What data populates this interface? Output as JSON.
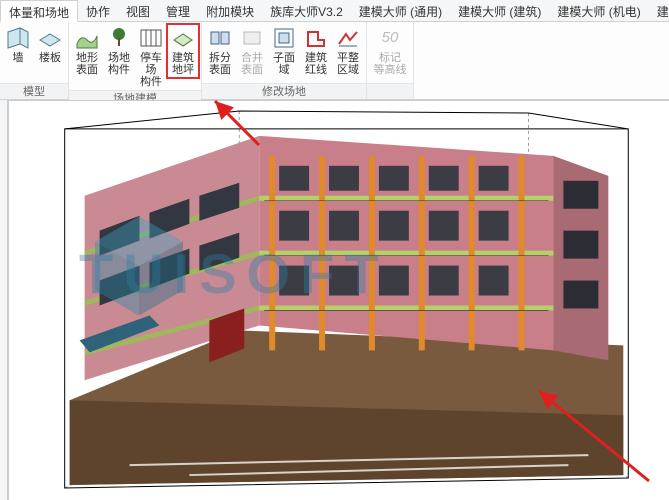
{
  "tabs": {
    "items": [
      {
        "label": "体量和场地",
        "active": true
      },
      {
        "label": "协作"
      },
      {
        "label": "视图"
      },
      {
        "label": "管理"
      },
      {
        "label": "附加模块"
      },
      {
        "label": "族库大师V3.2"
      },
      {
        "label": "建模大师 (通用)"
      },
      {
        "label": "建模大师 (建筑)"
      },
      {
        "label": "建模大师 (机电)"
      },
      {
        "label": "建模大师 (施工)"
      }
    ]
  },
  "ribbon": {
    "group0": {
      "label": "模型",
      "btn0": {
        "label": "墙",
        "icon": "wall-icon"
      },
      "btn1": {
        "label": "楼板",
        "icon": "floor-icon"
      }
    },
    "group1": {
      "label": "场地建模",
      "btn0": {
        "label": "地形表面",
        "icon": "terrain-icon"
      },
      "btn1": {
        "label": "场地\n构件",
        "icon": "site-component-icon"
      },
      "btn2": {
        "label": "停车场\n构件",
        "icon": "parking-icon"
      },
      "btn3": {
        "label": "建筑\n地坪",
        "icon": "building-pad-icon",
        "highlight": true
      }
    },
    "group2": {
      "label": "修改场地",
      "btn0": {
        "label": "拆分\n表面",
        "icon": "split-icon"
      },
      "btn1": {
        "label": "合并\n表面",
        "icon": "merge-icon",
        "disabled": true
      },
      "btn2": {
        "label": "子面域",
        "icon": "subregion-icon"
      },
      "btn3": {
        "label": "建筑\n红线",
        "icon": "property-line-icon"
      },
      "btn4": {
        "label": "平整\n区域",
        "icon": "graded-region-icon"
      }
    },
    "group3": {
      "label": "",
      "btn0": {
        "label": "标记\n等高线",
        "icon": "label-contour-icon",
        "value": "50",
        "disabled": true
      }
    }
  },
  "watermark": {
    "text": "TUISOFT"
  },
  "viewport": {
    "desc": "3D building model in bounding box"
  }
}
